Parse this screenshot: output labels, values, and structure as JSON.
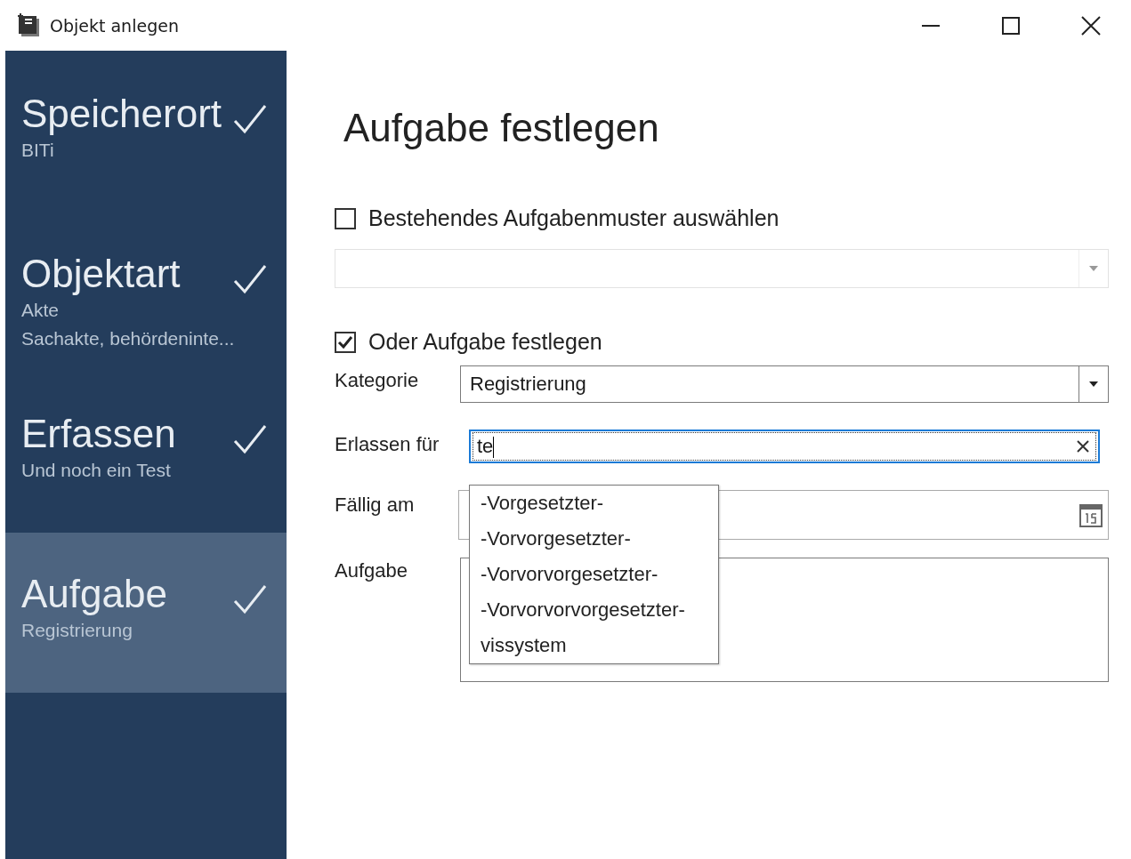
{
  "window": {
    "title": "Objekt anlegen"
  },
  "steps": [
    {
      "title": "Speicherort",
      "details": [
        "BITi"
      ],
      "done": true,
      "selected": false
    },
    {
      "title": "Objektart",
      "details": [
        "Akte",
        "Sachakte, behördeninte..."
      ],
      "done": true,
      "selected": false
    },
    {
      "title": "Erfassen",
      "details": [
        "Und noch ein Test"
      ],
      "done": true,
      "selected": false
    },
    {
      "title": "Aufgabe",
      "details": [
        "Registrierung"
      ],
      "done": true,
      "selected": true
    }
  ],
  "heading": "Aufgabe festlegen",
  "template_option": {
    "label": "Bestehendes Aufgabenmuster auswählen",
    "checked": false
  },
  "template_dropdown": {
    "disabled": true
  },
  "custom_option": {
    "label": "Oder Aufgabe festlegen",
    "checked": true
  },
  "form": {
    "category": {
      "label": "Kategorie",
      "value": "Registrierung"
    },
    "issued_for": {
      "label": "Erlassen für",
      "value": "te",
      "suggestions": [
        "-Vorgesetzter-",
        "-Vorvorgesetzter-",
        "-Vorvorvorgesetzter-",
        "-Vorvorvorvorgesetzter-",
        "vissystem"
      ]
    },
    "due": {
      "label": "Fällig am"
    },
    "task": {
      "label": "Aufgabe"
    }
  }
}
